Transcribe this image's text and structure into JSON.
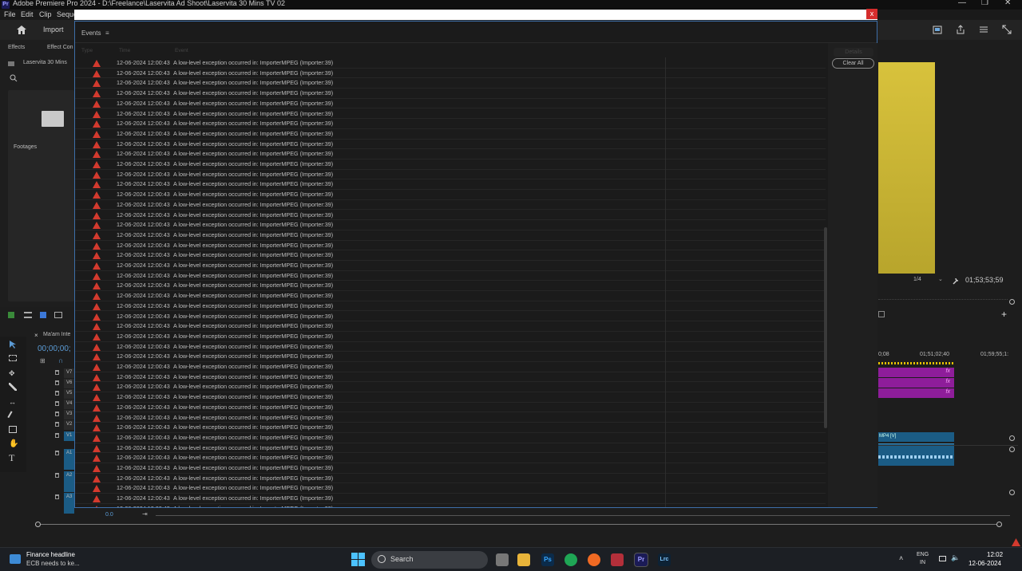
{
  "window": {
    "app_badge": "Pr",
    "title": "Adobe Premiere Pro 2024 - D:\\Freelance\\Laservita Ad Shoot\\Laservita 30 Mins TV 02",
    "minimize": "—",
    "maximize": "❐",
    "close": "✕"
  },
  "menu": {
    "items": [
      "File",
      "Edit",
      "Clip",
      "Seque"
    ]
  },
  "dialog_close": "x",
  "header": {
    "import_label": "Import"
  },
  "left_panel": {
    "tabs": [
      "Effects",
      "Effect Con"
    ],
    "project_item": "Laservita 30 Mins",
    "folder_label": "Footages"
  },
  "program_monitor": {
    "zoom": "1/4",
    "timecode": "01;53;53;59"
  },
  "timeline": {
    "sequence_tab": "Ma'am Inte",
    "timecode": "00;00;00;",
    "ruler_labels": [
      "0;08",
      "01;51;02;40",
      "01;59;55;1:"
    ],
    "tracks": [
      "V7",
      "V6",
      "V5",
      "V4",
      "V3",
      "V2",
      "V1",
      "A1",
      "A2",
      "A3"
    ],
    "audio_clip_label": "MP4 [V]",
    "fx_label": "fx",
    "zoom_value": "0.0"
  },
  "events_dialog": {
    "title": "Events",
    "menu_icon": "≡",
    "columns": [
      "Type",
      "Time",
      "Event"
    ],
    "details_button": "Details",
    "clear_all_button": "Clear All",
    "rows": [
      {
        "time": "12-06-2024 12:00:43",
        "event": "A low-level exception occurred in: ImporterMPEG (Importer:39)"
      },
      {
        "time": "12-06-2024 12:00:43",
        "event": "A low-level exception occurred in: ImporterMPEG (Importer:39)"
      },
      {
        "time": "12-06-2024 12:00:43",
        "event": "A low-level exception occurred in: ImporterMPEG (Importer:39)"
      },
      {
        "time": "12-06-2024 12:00:43",
        "event": "A low-level exception occurred in: ImporterMPEG (Importer:39)"
      },
      {
        "time": "12-06-2024 12:00:43",
        "event": "A low-level exception occurred in: ImporterMPEG (Importer:39)"
      },
      {
        "time": "12-06-2024 12:00:43",
        "event": "A low-level exception occurred in: ImporterMPEG (Importer:39)"
      },
      {
        "time": "12-06-2024 12:00:43",
        "event": "A low-level exception occurred in: ImporterMPEG (Importer:39)"
      },
      {
        "time": "12-06-2024 12:00:43",
        "event": "A low-level exception occurred in: ImporterMPEG (Importer:39)"
      },
      {
        "time": "12-06-2024 12:00:43",
        "event": "A low-level exception occurred in: ImporterMPEG (Importer:39)"
      },
      {
        "time": "12-06-2024 12:00:43",
        "event": "A low-level exception occurred in: ImporterMPEG (Importer:39)"
      },
      {
        "time": "12-06-2024 12:00:43",
        "event": "A low-level exception occurred in: ImporterMPEG (Importer:39)"
      },
      {
        "time": "12-06-2024 12:00:43",
        "event": "A low-level exception occurred in: ImporterMPEG (Importer:39)"
      },
      {
        "time": "12-06-2024 12:00:43",
        "event": "A low-level exception occurred in: ImporterMPEG (Importer:39)"
      },
      {
        "time": "12-06-2024 12:00:43",
        "event": "A low-level exception occurred in: ImporterMPEG (Importer:39)"
      },
      {
        "time": "12-06-2024 12:00:43",
        "event": "A low-level exception occurred in: ImporterMPEG (Importer:39)"
      },
      {
        "time": "12-06-2024 12:00:43",
        "event": "A low-level exception occurred in: ImporterMPEG (Importer:39)"
      },
      {
        "time": "12-06-2024 12:00:43",
        "event": "A low-level exception occurred in: ImporterMPEG (Importer:39)"
      },
      {
        "time": "12-06-2024 12:00:43",
        "event": "A low-level exception occurred in: ImporterMPEG (Importer:39)"
      },
      {
        "time": "12-06-2024 12:00:43",
        "event": "A low-level exception occurred in: ImporterMPEG (Importer:39)"
      },
      {
        "time": "12-06-2024 12:00:43",
        "event": "A low-level exception occurred in: ImporterMPEG (Importer:39)"
      },
      {
        "time": "12-06-2024 12:00:43",
        "event": "A low-level exception occurred in: ImporterMPEG (Importer:39)"
      },
      {
        "time": "12-06-2024 12:00:43",
        "event": "A low-level exception occurred in: ImporterMPEG (Importer:39)"
      },
      {
        "time": "12-06-2024 12:00:43",
        "event": "A low-level exception occurred in: ImporterMPEG (Importer:39)"
      },
      {
        "time": "12-06-2024 12:00:43",
        "event": "A low-level exception occurred in: ImporterMPEG (Importer:39)"
      },
      {
        "time": "12-06-2024 12:00:43",
        "event": "A low-level exception occurred in: ImporterMPEG (Importer:39)"
      },
      {
        "time": "12-06-2024 12:00:43",
        "event": "A low-level exception occurred in: ImporterMPEG (Importer:39)"
      },
      {
        "time": "12-06-2024 12:00:43",
        "event": "A low-level exception occurred in: ImporterMPEG (Importer:39)"
      },
      {
        "time": "12-06-2024 12:00:43",
        "event": "A low-level exception occurred in: ImporterMPEG (Importer:39)"
      },
      {
        "time": "12-06-2024 12:00:43",
        "event": "A low-level exception occurred in: ImporterMPEG (Importer:39)"
      },
      {
        "time": "12-06-2024 12:00:43",
        "event": "A low-level exception occurred in: ImporterMPEG (Importer:39)"
      },
      {
        "time": "12-06-2024 12:00:43",
        "event": "A low-level exception occurred in: ImporterMPEG (Importer:39)"
      },
      {
        "time": "12-06-2024 12:00:43",
        "event": "A low-level exception occurred in: ImporterMPEG (Importer:39)"
      },
      {
        "time": "12-06-2024 12:00:43",
        "event": "A low-level exception occurred in: ImporterMPEG (Importer:39)"
      },
      {
        "time": "12-06-2024 12:00:43",
        "event": "A low-level exception occurred in: ImporterMPEG (Importer:39)"
      },
      {
        "time": "12-06-2024 12:00:43",
        "event": "A low-level exception occurred in: ImporterMPEG (Importer:39)"
      },
      {
        "time": "12-06-2024 12:00:43",
        "event": "A low-level exception occurred in: ImporterMPEG (Importer:39)"
      },
      {
        "time": "12-06-2024 12:00:43",
        "event": "A low-level exception occurred in: ImporterMPEG (Importer:39)"
      },
      {
        "time": "12-06-2024 12:00:43",
        "event": "A low-level exception occurred in: ImporterMPEG (Importer:39)"
      },
      {
        "time": "12-06-2024 12:00:43",
        "event": "A low-level exception occurred in: ImporterMPEG (Importer:39)"
      },
      {
        "time": "12-06-2024 12:00:43",
        "event": "A low-level exception occurred in: ImporterMPEG (Importer:39)"
      },
      {
        "time": "12-06-2024 12:00:43",
        "event": "A low-level exception occurred in: ImporterMPEG (Importer:39)"
      },
      {
        "time": "12-06-2024 12:00:43",
        "event": "A low-level exception occurred in: ImporterMPEG (Importer:39)"
      },
      {
        "time": "12-06-2024 12:00:43",
        "event": "A low-level exception occurred in: ImporterMPEG (Importer:39)"
      },
      {
        "time": "12-06-2024 12:00:43",
        "event": "A low-level exception occurred in: ImporterMPEG (Importer:39)"
      },
      {
        "time": "12-06-2024 12:00:43",
        "event": "A low-level exception occurred in: ImporterMPEG (Importer:39)"
      }
    ]
  },
  "taskbar": {
    "news_title": "Finance headline",
    "news_sub": "ECB needs to ke...",
    "search_placeholder": "Search",
    "apps": [
      "Ps",
      "Pr",
      "Lrc"
    ],
    "lang_top": "ENG",
    "lang_bottom": "IN",
    "time": "12:02",
    "date": "12-06-2024"
  },
  "colors": {
    "accent_border": "#3d6ea8",
    "warning": "#d33a2e",
    "clip_purple": "#8e1d9a",
    "clip_blue": "#1b5c85",
    "monitor_yellow": "#d8c23c"
  }
}
